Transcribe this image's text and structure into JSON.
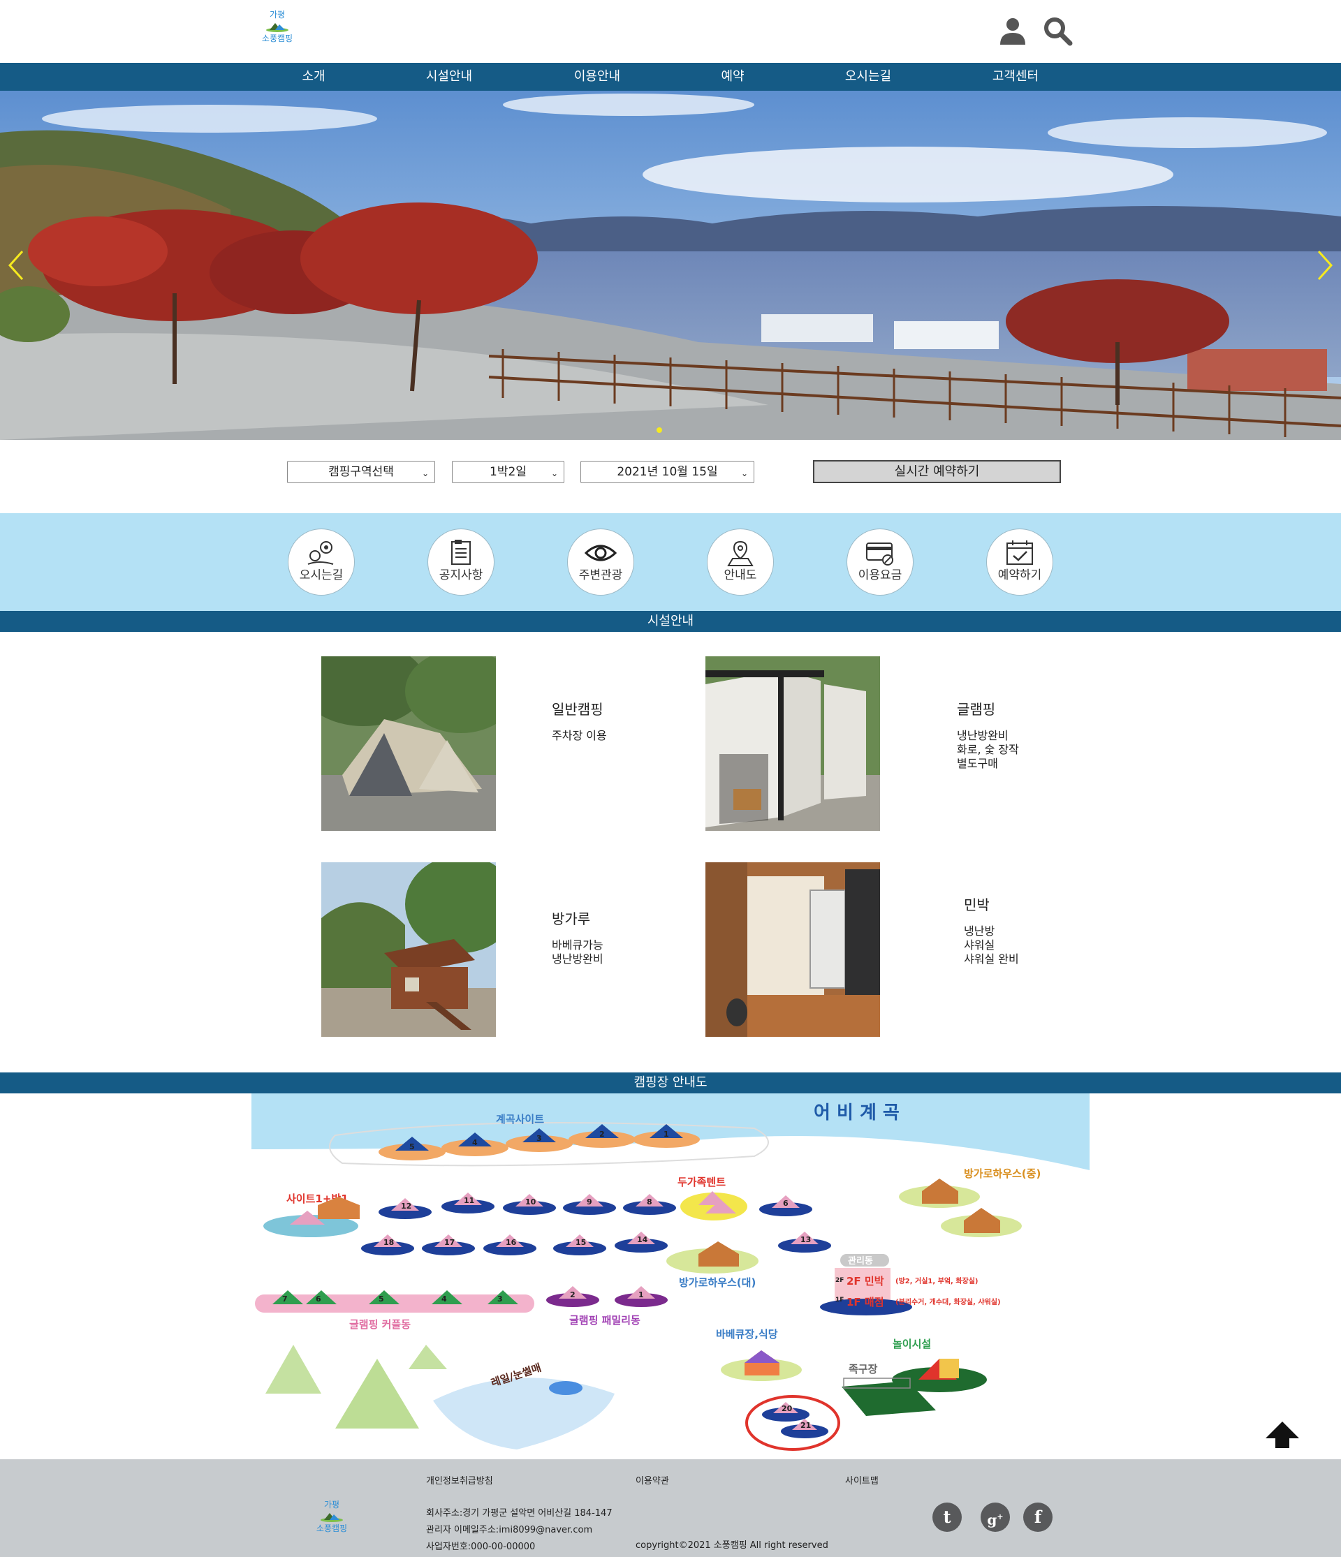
{
  "header": {
    "logo_top": "가평",
    "logo_bottom": "소풍캠핑",
    "user_icon": "user-icon",
    "search_icon": "search-icon"
  },
  "nav": {
    "items": [
      "소개",
      "시설안내",
      "이용안내",
      "예약",
      "오시는길",
      "고객센터"
    ]
  },
  "hero": {
    "prev_icon": "chevron-left-icon",
    "next_icon": "chevron-right-icon",
    "accent_color": "#f6ea1f"
  },
  "booking": {
    "area_select": "캠핑구역선택",
    "stay_select": "1박2일",
    "date_select": "2021년 10월 15일",
    "reserve_button": "실시간 예약하기"
  },
  "quick_menu": {
    "items": [
      {
        "label": "오시는길",
        "icon": "map-pin-icon"
      },
      {
        "label": "공지사항",
        "icon": "notice-document-icon"
      },
      {
        "label": "주변관광",
        "icon": "eye-icon"
      },
      {
        "label": "안내도",
        "icon": "map-icon"
      },
      {
        "label": "이용요금",
        "icon": "payment-card-icon"
      },
      {
        "label": "예약하기",
        "icon": "calendar-check-icon"
      }
    ]
  },
  "facilities": {
    "section_title": "시설안내",
    "items": [
      {
        "title": "일반캠핑",
        "desc": [
          "주차장 이용"
        ]
      },
      {
        "title": "글램핑",
        "desc": [
          "냉난방완비",
          "화로, 숯 장작",
          "별도구매"
        ]
      },
      {
        "title": "방가루",
        "desc": [
          "바베큐가능",
          "냉난방완비"
        ]
      },
      {
        "title": "민박",
        "desc": [
          "냉난방",
          "샤워실",
          "샤워실 완비"
        ]
      }
    ]
  },
  "map": {
    "section_title": "캠핑장 안내도",
    "stream": "어 비 계 곡",
    "valley_site": "계곡사이트",
    "two_family": "두가족텐트",
    "site1_room1": "사이트1+방1",
    "bungalow_mid": "방가로하우스(중)",
    "bungalow_large": "방가로하우스(대)",
    "office": "관리동",
    "office_2f": "2F 민박",
    "office_2f_note": "(방2, 거실1, 부엌, 화장실)",
    "office_1f": "1F 매점",
    "office_1f_note": "(분리수거, 개수대, 화장실, 샤워실)",
    "glamping_couple": "글램핑 커플동",
    "glamping_family": "글램핑 패밀리동",
    "bbq": "바베큐장,식당",
    "playground": "놀이시설",
    "sled": "레일/눈썰매",
    "foot_volleyball": "족구장",
    "floor_2f": "2F",
    "floor_1f": "1F"
  },
  "footer": {
    "privacy": "개인정보취급방침",
    "terms": "이용약관",
    "sitemap": "사이트맵",
    "address": "회사주소:경기 가평군 설악면 어비산길 184-147",
    "email": "관리자 이메일주소:imi8099@naver.com",
    "biz_no": "사업자번호:000-00-00000",
    "copyright": "copyright©2021 소풍캠핑 All right reserved",
    "logo_top": "가평",
    "logo_bottom": "소풍캠핑",
    "social": [
      "tumblr-icon",
      "google-plus-icon",
      "facebook-icon"
    ]
  }
}
